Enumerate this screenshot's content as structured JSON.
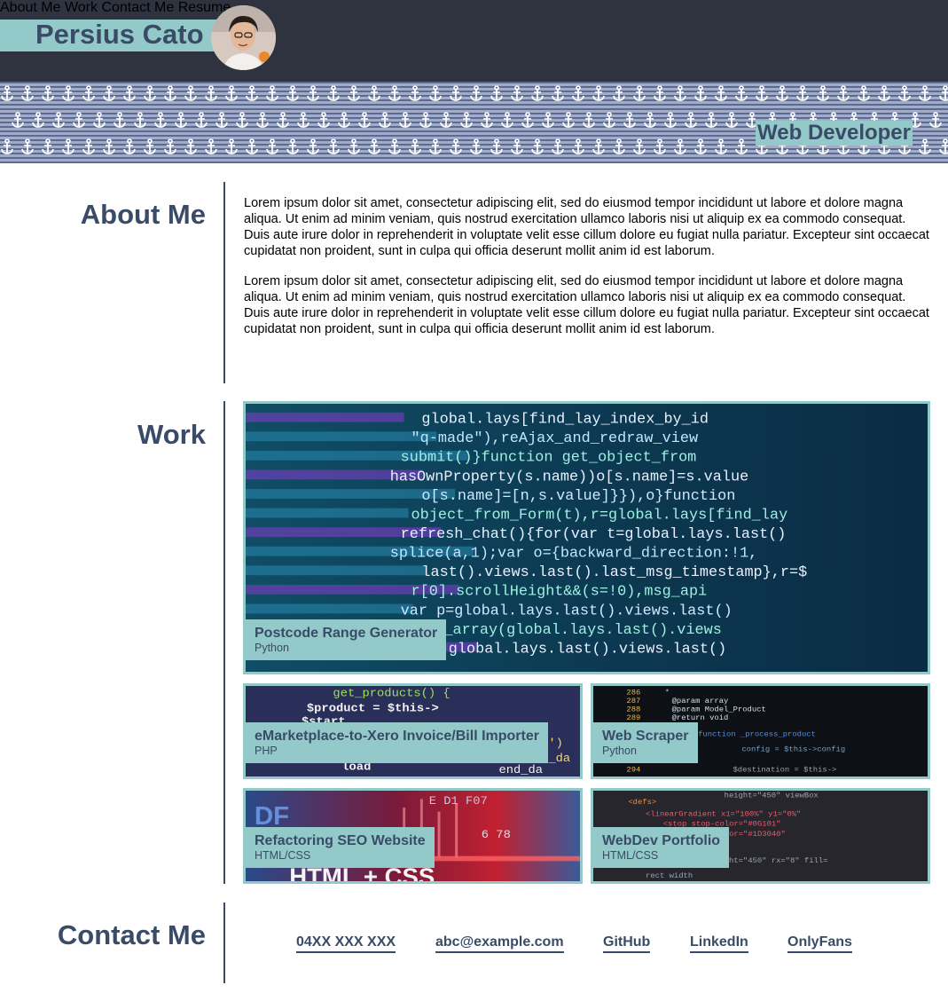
{
  "header": {
    "name": "Persius Cato",
    "nav": [
      "About Me",
      "Work",
      "Contact Me",
      "Resume"
    ]
  },
  "banner": {
    "tagline": "Web Developer"
  },
  "about": {
    "title": "About Me",
    "paragraphs": [
      "Lorem ipsum dolor sit amet, consectetur adipiscing elit, sed do eiusmod tempor incididunt ut labore et dolore magna aliqua. Ut enim ad minim veniam, quis nostrud exercitation ullamco laboris nisi ut aliquip ex ea commodo consequat. Duis aute irure dolor in reprehenderit in voluptate velit esse cillum dolore eu fugiat nulla pariatur. Excepteur sint occaecat cupidatat non proident, sunt in culpa qui officia deserunt mollit anim id est laborum.",
      "Lorem ipsum dolor sit amet, consectetur adipiscing elit, sed do eiusmod tempor incididunt ut labore et dolore magna aliqua. Ut enim ad minim veniam, quis nostrud exercitation ullamco laboris nisi ut aliquip ex ea commodo consequat. Duis aute irure dolor in reprehenderit in voluptate velit esse cillum dolore eu fugiat nulla pariatur. Excepteur sint occaecat cupidatat non proident, sunt in culpa qui officia deserunt mollit anim id est laborum."
    ]
  },
  "work": {
    "title": "Work",
    "projects": [
      {
        "title": "Postcode Range Generator",
        "tech": "Python"
      },
      {
        "title": "eMarketplace-to-Xero Invoice/Bill Importer",
        "tech": "PHP"
      },
      {
        "title": "Web Scraper",
        "tech": "Python"
      },
      {
        "title": "Refactoring SEO Website",
        "tech": "HTML/CSS"
      },
      {
        "title": "WebDev Portfolio",
        "tech": "HTML/CSS"
      }
    ]
  },
  "contact": {
    "title": "Contact Me",
    "links": [
      "04XX XXX XXX",
      "abc@example.com",
      "GitHub",
      "LinkedIn",
      "OnlyFans"
    ]
  },
  "colors": {
    "header_bg": "#2f3340",
    "accent": "#93c9c9",
    "heading": "#394b66",
    "banner_dark": "#5b6a93",
    "banner_light": "#a2acc6"
  },
  "icons": [
    "anchor-icon",
    "avatar-photo"
  ]
}
